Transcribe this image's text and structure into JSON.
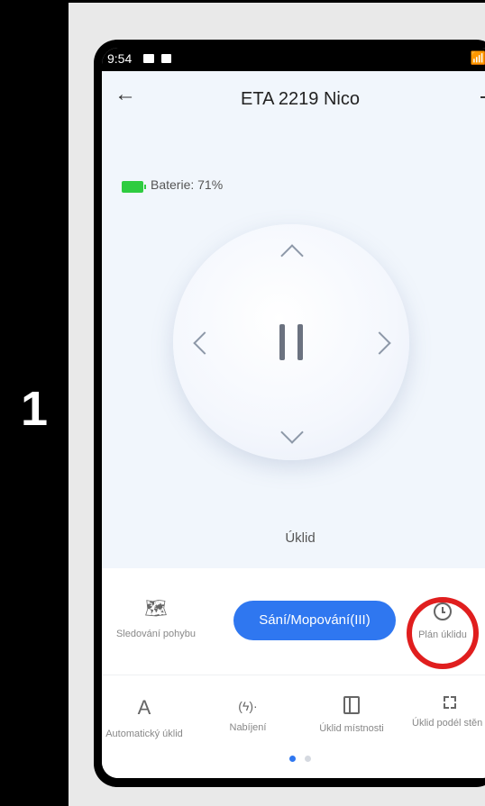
{
  "step_number": "1",
  "status_bar": {
    "time": "9:54"
  },
  "app_bar": {
    "title": "ETA 2219 Nico"
  },
  "battery": {
    "label": "Baterie: 71%",
    "level": 0.71,
    "color": "#2ecc40"
  },
  "joystick": {
    "state": "paused"
  },
  "mode_label": "Úklid",
  "actions_row1": [
    {
      "label": "Sledování pohybu",
      "icon": "map-icon"
    },
    {
      "label": "Sání/Mopování(III)",
      "icon": "mode-button"
    },
    {
      "label": "Plán úklidu",
      "icon": "clock-icon"
    }
  ],
  "actions_row2": [
    {
      "label": "Automatický úklid",
      "icon": "letter-a-icon",
      "glyph": "A"
    },
    {
      "label": "Nabíjení",
      "icon": "charging-icon",
      "glyph": "(ϟ)·"
    },
    {
      "label": "Úklid místnosti",
      "icon": "room-icon"
    },
    {
      "label": "Úklid podél stěn",
      "icon": "wall-frame-icon"
    }
  ],
  "pager": {
    "active": 0,
    "count": 2
  },
  "colors": {
    "accent": "#2f77f0",
    "highlight_ring": "#e01e1e"
  }
}
